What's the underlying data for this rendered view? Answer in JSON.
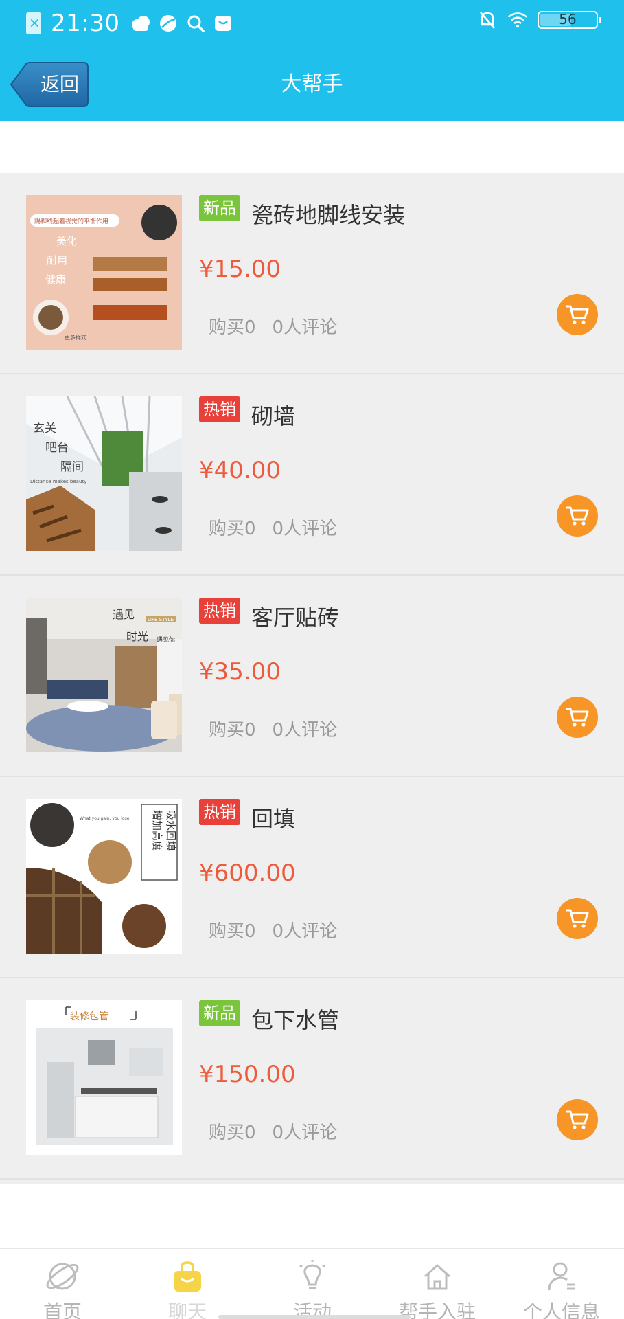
{
  "status_bar": {
    "time": "21:30",
    "battery": "56",
    "icons": [
      "sim-icon",
      "cloud-icon",
      "leaf-icon",
      "search-icon",
      "message-icon",
      "mute-bell-icon",
      "wifi-icon",
      "battery-icon"
    ]
  },
  "nav": {
    "back_label": "返回",
    "title": "大帮手"
  },
  "products": [
    {
      "tag": "新品",
      "tag_type": "new",
      "name": "瓷砖地脚线安装",
      "price": "¥15.00",
      "bought": "购买0",
      "reviews": "0人评论",
      "image_text": [
        "踢脚线起着视觉的平衡作用",
        "美化",
        "耐用",
        "健康",
        "更多样式"
      ]
    },
    {
      "tag": "热销",
      "tag_type": "hot",
      "name": "砌墙",
      "price": "¥40.00",
      "bought": "购买0",
      "reviews": "0人评论",
      "image_text": [
        "玄关",
        "吧台",
        "隔间",
        "Distance makes beauty"
      ]
    },
    {
      "tag": "热销",
      "tag_type": "hot",
      "name": "客厅贴砖",
      "price": "¥35.00",
      "bought": "购买0",
      "reviews": "0人评论",
      "image_text": [
        "遇见",
        "时光",
        "遇见你",
        "LIFE STYLE"
      ]
    },
    {
      "tag": "热销",
      "tag_type": "hot",
      "name": "回填",
      "price": "¥600.00",
      "bought": "购买0",
      "reviews": "0人评论",
      "image_text": [
        "增加高度",
        "吸水回填",
        "What you gain, you lose"
      ]
    },
    {
      "tag": "新品",
      "tag_type": "new",
      "name": "包下水管",
      "price": "¥150.00",
      "bought": "购买0",
      "reviews": "0人评论",
      "image_text": [
        "装修包管"
      ]
    }
  ],
  "tabbar": {
    "tabs": [
      {
        "label": "首页",
        "icon": "planet-icon",
        "active": false
      },
      {
        "label": "聊天",
        "icon": "bag-icon",
        "active": true
      },
      {
        "label": "活动",
        "icon": "lightbulb-icon",
        "active": false
      },
      {
        "label": "帮手入驻",
        "icon": "house-icon",
        "active": false
      },
      {
        "label": "个人信息",
        "icon": "person-icon",
        "active": false
      }
    ]
  },
  "colors": {
    "header": "#1fc0ec",
    "tag_new": "#7ac53b",
    "tag_hot": "#e8413a",
    "price": "#ee5b3c",
    "cart": "#f79526",
    "active_tab_icon": "#f5d547"
  }
}
